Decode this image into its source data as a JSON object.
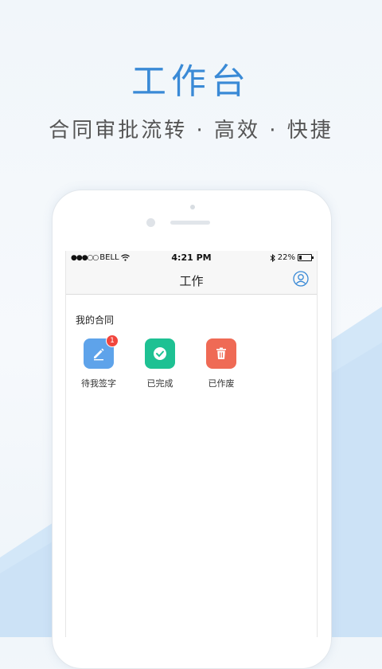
{
  "headline": "工作台",
  "subline": "合同审批流转 · 高效 · 快捷",
  "status_bar": {
    "carrier": "BELL",
    "signal_dots": "●●●○○",
    "time": "4:21 PM",
    "battery_percent": "22%",
    "battery_level": 0.22
  },
  "nav": {
    "title": "工作"
  },
  "section": {
    "title": "我的合同"
  },
  "tiles": [
    {
      "label": "待我签字",
      "icon": "edit-icon",
      "color": "#5ea3ea",
      "badge": "1"
    },
    {
      "label": "已完成",
      "icon": "check-circle-icon",
      "color": "#1ec193"
    },
    {
      "label": "已作废",
      "icon": "trash-icon",
      "color": "#ef6a55"
    }
  ],
  "colors": {
    "headline": "#3a8ad6",
    "accent": "#3a8ad6",
    "background_shape": "#cfe4f6"
  }
}
